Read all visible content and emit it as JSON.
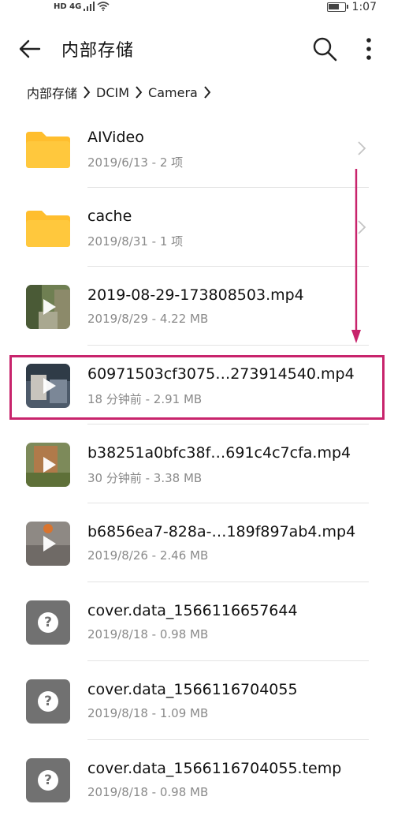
{
  "status_bar": {
    "network_labels": "HD 4G",
    "time": "1:07",
    "battery_level": 0.7
  },
  "header": {
    "title": "内部存储"
  },
  "breadcrumb": [
    "内部存储",
    "DCIM",
    "Camera"
  ],
  "files": [
    {
      "name": "AIVideo",
      "meta": "2019/6/13 - 2 项",
      "type": "folder"
    },
    {
      "name": "cache",
      "meta": "2019/8/31 - 1 项",
      "type": "folder"
    },
    {
      "name": "2019-08-29-173808503.mp4",
      "meta": "2019/8/29 - 4.22 MB",
      "type": "video"
    },
    {
      "name": "60971503cf3075…273914540.mp4",
      "meta": "18 分钟前 - 2.91 MB",
      "type": "video"
    },
    {
      "name": "b38251a0bfc38f…691c4c7cfa.mp4",
      "meta": "30 分钟前 - 3.38 MB",
      "type": "video"
    },
    {
      "name": "b6856ea7-828a-…189f897ab4.mp4",
      "meta": "2019/8/26 - 2.46 MB",
      "type": "video"
    },
    {
      "name": "cover.data_1566116657644",
      "meta": "2019/8/18 - 0.98 MB",
      "type": "unknown"
    },
    {
      "name": "cover.data_1566116704055",
      "meta": "2019/8/18 - 1.09 MB",
      "type": "unknown"
    },
    {
      "name": "cover.data_1566116704055.temp",
      "meta": "2019/8/18 - 0.98 MB",
      "type": "unknown"
    }
  ],
  "colors": {
    "folder": "#FFBE2E",
    "annotation": "#C8246C",
    "unknown_icon_bg": "#717171"
  }
}
